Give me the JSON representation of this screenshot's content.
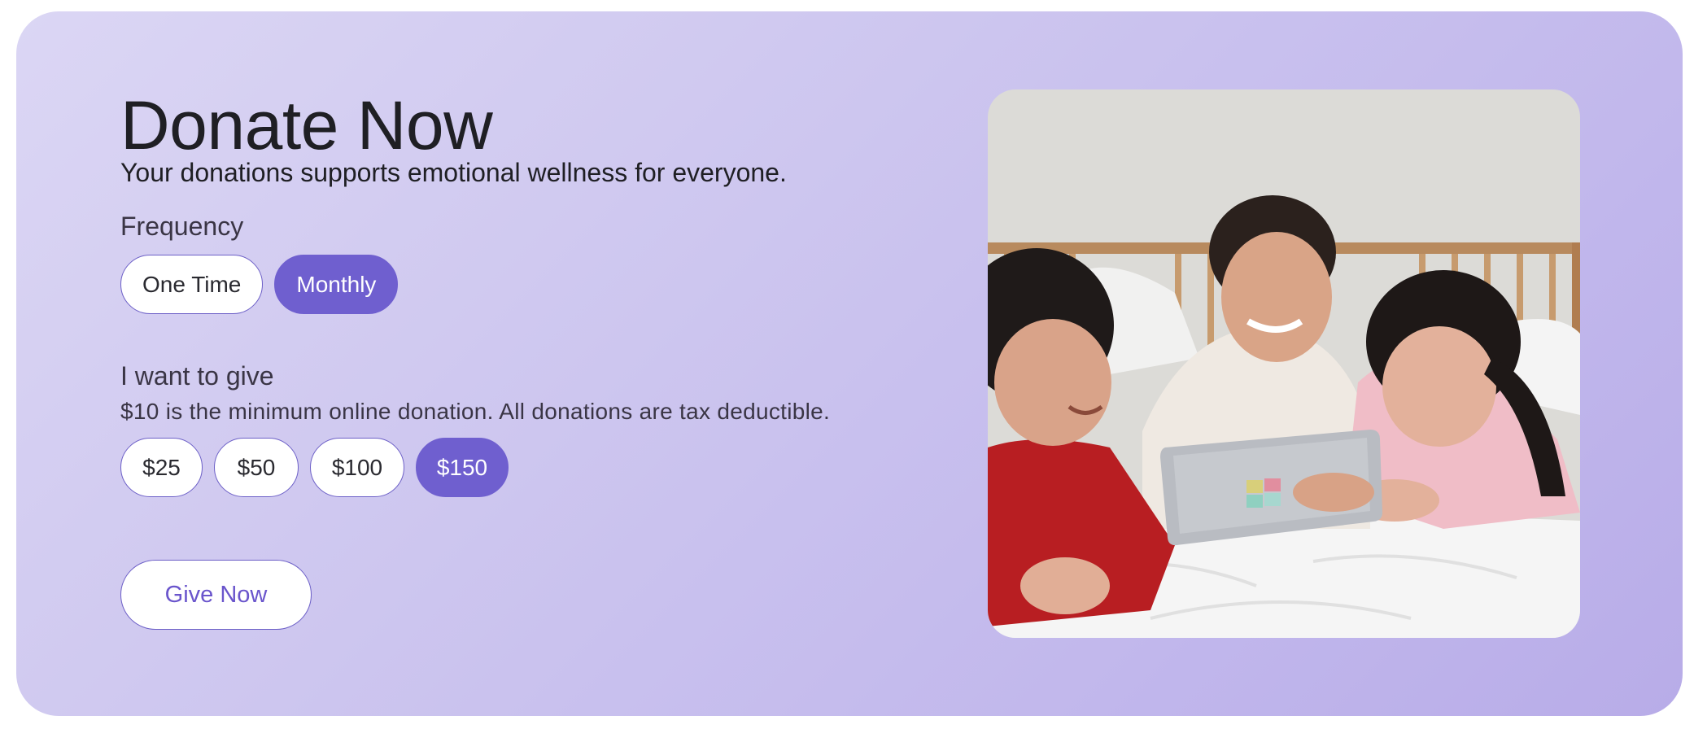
{
  "hero": {
    "title": "Donate Now",
    "subtitle": "Your donations supports emotional wellness for everyone."
  },
  "frequency": {
    "label": "Frequency",
    "options": [
      "One Time",
      "Monthly"
    ],
    "selected": "Monthly"
  },
  "amount": {
    "label": "I want to give",
    "note": "$10 is the minimum online donation. All donations are tax deductible.",
    "options": [
      "$25",
      "$50",
      "$100",
      "$150"
    ],
    "selected": "$150"
  },
  "cta": {
    "label": "Give Now"
  },
  "colors": {
    "accent": "#6f5fcf",
    "background_start": "#dbd6f4",
    "background_end": "#b8ace8",
    "cta_text": "#6a55cc"
  }
}
